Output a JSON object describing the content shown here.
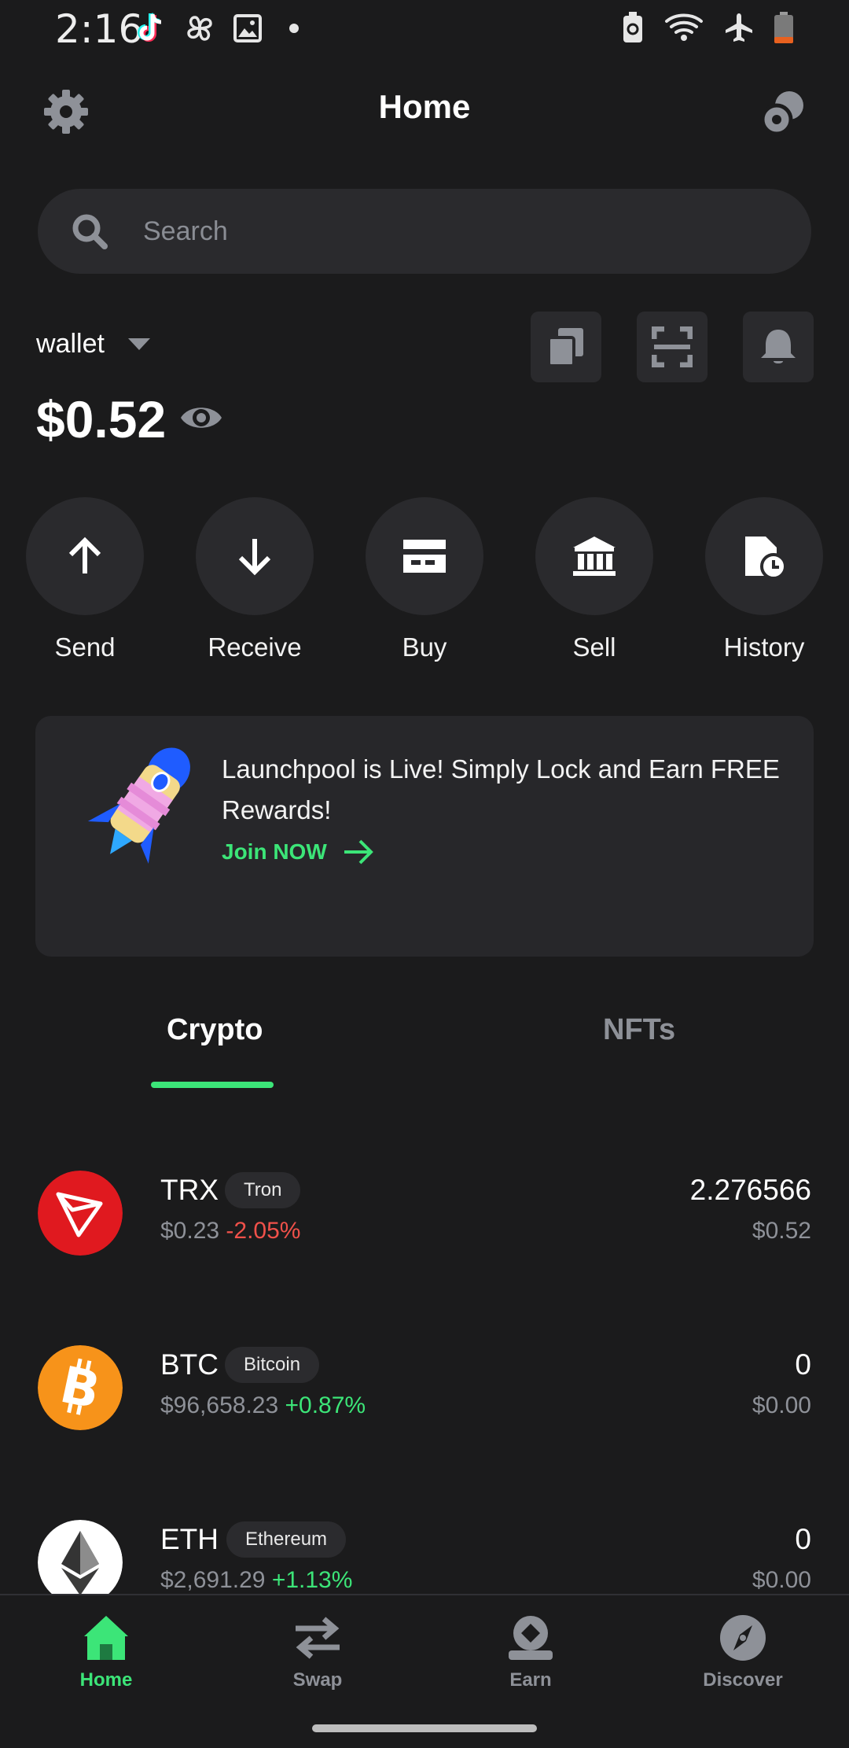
{
  "status_bar": {
    "time": "2:16",
    "icons_left": [
      "tiktok-icon",
      "pinwheel-icon",
      "image-icon",
      "dot-icon"
    ],
    "icons_right": [
      "battery-saver-icon",
      "wifi-icon",
      "airplane-icon",
      "battery-low-icon"
    ]
  },
  "header": {
    "title": "Home",
    "left_icon": "gear-icon",
    "right_icon": "coins-icon"
  },
  "search": {
    "placeholder": "Search"
  },
  "wallet": {
    "name": "wallet",
    "balance": "$0.52",
    "buttons": [
      "copy-icon",
      "scan-icon",
      "bell-icon"
    ]
  },
  "actions": [
    {
      "label": "Send",
      "icon": "arrow-up-icon"
    },
    {
      "label": "Receive",
      "icon": "arrow-down-icon"
    },
    {
      "label": "Buy",
      "icon": "card-icon"
    },
    {
      "label": "Sell",
      "icon": "bank-icon"
    },
    {
      "label": "History",
      "icon": "history-icon"
    }
  ],
  "banner": {
    "text": "Launchpool is Live! Simply Lock and Earn FREE Rewards!",
    "cta": "Join NOW",
    "image": "rocket-icon"
  },
  "tabs": [
    {
      "label": "Crypto",
      "active": true
    },
    {
      "label": "NFTs",
      "active": false
    }
  ],
  "assets": [
    {
      "symbol": "TRX",
      "name": "Tron",
      "price": "$0.23",
      "change": "-2.05%",
      "amount": "2.276566",
      "value": "$0.52",
      "color": "#e0191f"
    },
    {
      "symbol": "BTC",
      "name": "Bitcoin",
      "price": "$96,658.23",
      "change": "+0.87%",
      "amount": "0",
      "value": "$0.00",
      "color": "#f7931a"
    },
    {
      "symbol": "ETH",
      "name": "Ethereum",
      "price": "$2,691.29",
      "change": "+1.13%",
      "amount": "0",
      "value": "$0.00",
      "color": "#ffffff"
    }
  ],
  "bottom_nav": [
    {
      "label": "Home",
      "icon": "home-icon",
      "active": true
    },
    {
      "label": "Swap",
      "icon": "swap-icon",
      "active": false
    },
    {
      "label": "Earn",
      "icon": "earn-icon",
      "active": false
    },
    {
      "label": "Discover",
      "icon": "compass-icon",
      "active": false
    }
  ],
  "colors": {
    "background": "#1b1b1c",
    "surface": "#2a2a2d",
    "accent": "#3ce578",
    "negative": "#f0514a"
  }
}
